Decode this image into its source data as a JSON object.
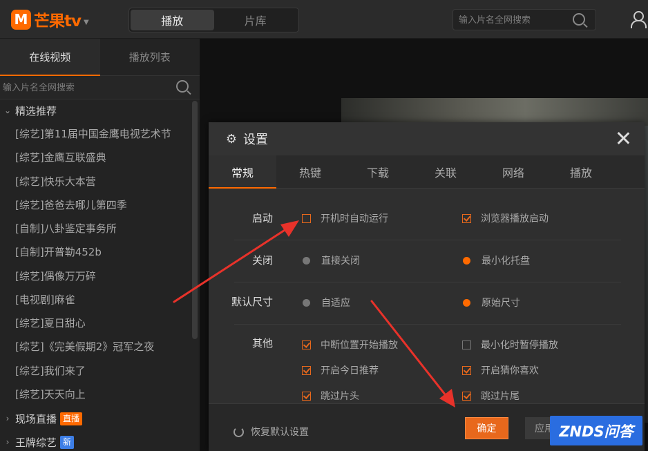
{
  "app": {
    "logo_mark": "M",
    "logo_text": "芒果tv",
    "mode_tabs": [
      "播放",
      "片库"
    ],
    "active_mode": 0,
    "search_placeholder": "输入片名全网搜索"
  },
  "sidebar": {
    "tabs": [
      "在线视频",
      "播放列表"
    ],
    "search_placeholder": "输入片名全网搜索",
    "featured_title": "精选推荐",
    "items": [
      "[综艺]第11届中国金鹰电视艺术节",
      "[综艺]金鹰互联盛典",
      "[综艺]快乐大本营",
      "[综艺]爸爸去哪儿第四季",
      "[自制]八卦鉴定事务所",
      "[自制]开普勒452b",
      "[综艺]偶像万万碎",
      "[电视剧]麻雀",
      "[综艺]夏日甜心",
      "[综艺]《完美假期2》冠军之夜",
      "[综艺]我们来了",
      "[综艺]天天向上"
    ],
    "live_section": {
      "label": "现场直播",
      "badge": "直播"
    },
    "ace_section": {
      "label": "王牌综艺",
      "badge": "新"
    }
  },
  "dialog": {
    "title": "设置",
    "tabs": [
      "常规",
      "热键",
      "下载",
      "关联",
      "网络",
      "播放"
    ],
    "active_tab": 0,
    "rows": {
      "startup": {
        "label": "启动",
        "options": [
          {
            "label": "开机时自动运行",
            "checked": false
          },
          {
            "label": "浏览器播放启动",
            "checked": true
          }
        ]
      },
      "close": {
        "label": "关闭",
        "options": [
          {
            "label": "直接关闭",
            "selected": false
          },
          {
            "label": "最小化托盘",
            "selected": true
          }
        ]
      },
      "default_size": {
        "label": "默认尺寸",
        "options": [
          {
            "label": "自适应",
            "selected": false
          },
          {
            "label": "原始尺寸",
            "selected": true
          }
        ]
      },
      "other": {
        "label": "其他",
        "options": [
          {
            "label": "中断位置开始播放",
            "checked": true
          },
          {
            "label": "最小化时暂停播放",
            "checked": false
          },
          {
            "label": "开启今日推荐",
            "checked": true
          },
          {
            "label": "开启猜你喜欢",
            "checked": true
          },
          {
            "label": "跳过片头",
            "checked": true
          },
          {
            "label": "跳过片尾",
            "checked": true
          }
        ]
      }
    },
    "reset_label": "恢复默认设置",
    "ok_label": "确定",
    "apply_label": "应用"
  },
  "watermark": "ZNDS问答",
  "colors": {
    "accent": "#ff6a00",
    "arrow": "#e8322a",
    "watermark_bg": "#2a6de0"
  }
}
